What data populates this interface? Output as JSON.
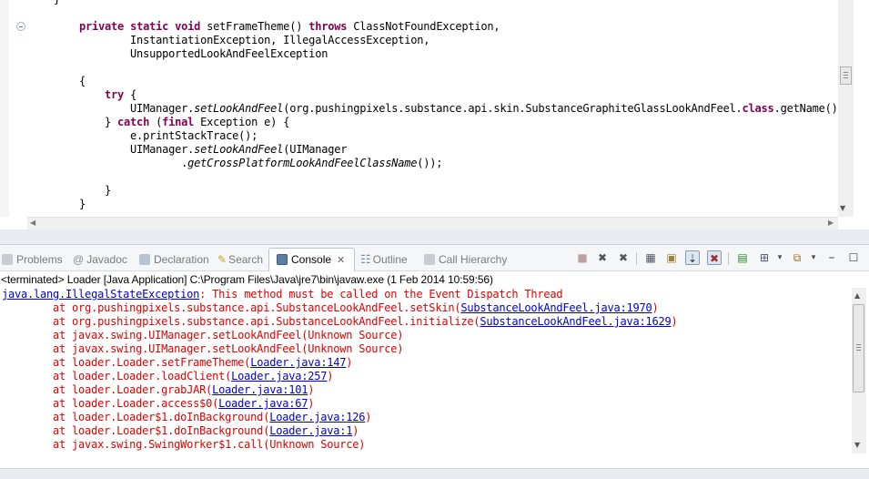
{
  "editor": {
    "lines": [
      {
        "i": "}",
        "t": ""
      },
      {
        "i": "    ",
        "k": "private static void",
        "t": " setFrameTheme() ",
        "k2": "throws",
        "t2": " ClassNotFoundException,"
      },
      {
        "t": "            InstantiationException, IllegalAccessException,"
      },
      {
        "t": "            UnsupportedLookAndFeelException"
      },
      {
        "t": ""
      },
      {
        "t": "    {"
      },
      {
        "t": "        ",
        "k": "try",
        "t2": " {"
      },
      {
        "t": "            UIManager.",
        "it": "setLookAndFeel",
        "t2": "(org.pushingpixels.substance.api.skin.SubstanceGraphiteGlassLookAndFeel.",
        "k": "class",
        "t3": ".getName());"
      },
      {
        "t": "        } ",
        "k": "catch",
        "t2": " (",
        "k2": "final",
        "t3": " Exception e) {"
      },
      {
        "t": "            e.printStackTrace();"
      },
      {
        "t": "            UIManager.",
        "it": "setLookAndFeel",
        "t2": "(UIManager"
      },
      {
        "t": "                    .",
        "it": "getCrossPlatformLookAndFeelClassName",
        "t2": "());"
      },
      {
        "t": ""
      },
      {
        "t": "        }"
      },
      {
        "t": "    }"
      }
    ]
  },
  "tabs": [
    {
      "label": "Problems",
      "icon": "problems-icon"
    },
    {
      "label": "Javadoc",
      "icon": "javadoc-icon"
    },
    {
      "label": "Declaration",
      "icon": "declaration-icon"
    },
    {
      "label": "Search",
      "icon": "search-icon"
    },
    {
      "label": "Console",
      "icon": "console-icon",
      "active": true
    },
    {
      "label": "Outline",
      "icon": "outline-icon"
    },
    {
      "label": "Call Hierarchy",
      "icon": "call-hierarchy-icon"
    }
  ],
  "console": {
    "header": "<terminated> Loader [Java Application] C:\\Program Files\\Java\\jre7\\bin\\javaw.exe (1 Feb 2014 10:59:56)",
    "exception_class": "java.lang.IllegalStateException",
    "exception_msg": ": This method must be called on the Event Dispatch Thread",
    "frames": [
      {
        "text": "at org.pushingpixels.substance.api.SubstanceLookAndFeel.setSkin(",
        "link": "SubstanceLookAndFeel.java:1970",
        "end": ")"
      },
      {
        "text": "at org.pushingpixels.substance.api.SubstanceLookAndFeel.initialize(",
        "link": "SubstanceLookAndFeel.java:1629",
        "end": ")"
      },
      {
        "text": "at javax.swing.UIManager.setLookAndFeel(Unknown Source)",
        "link": "",
        "end": ""
      },
      {
        "text": "at javax.swing.UIManager.setLookAndFeel(Unknown Source)",
        "link": "",
        "end": ""
      },
      {
        "text": "at loader.Loader.setFrameTheme(",
        "link": "Loader.java:147",
        "end": ")"
      },
      {
        "text": "at loader.Loader.loadClient(",
        "link": "Loader.java:257",
        "end": ")"
      },
      {
        "text": "at loader.Loader.grabJAR(",
        "link": "Loader.java:101",
        "end": ")"
      },
      {
        "text": "at loader.Loader.access$0(",
        "link": "Loader.java:67",
        "end": ")"
      },
      {
        "text": "at loader.Loader$1.doInBackground(",
        "link": "Loader.java:126",
        "end": ")"
      },
      {
        "text": "at loader.Loader$1.doInBackground(",
        "link": "Loader.java:1",
        "end": ")"
      },
      {
        "text": "at javax.swing.SwingWorker$1.call(Unknown Source)",
        "link": "",
        "end": ""
      }
    ]
  },
  "toolbar_glyphs": {
    "terminate": "■",
    "remove": "✖",
    "remove_all": "✖",
    "scroll_lock": "⇣",
    "pin": "▤",
    "new_console": "⊞",
    "open_console": "▾",
    "minimize": "▭",
    "maximize": "☐",
    "view_menu": "▾"
  }
}
